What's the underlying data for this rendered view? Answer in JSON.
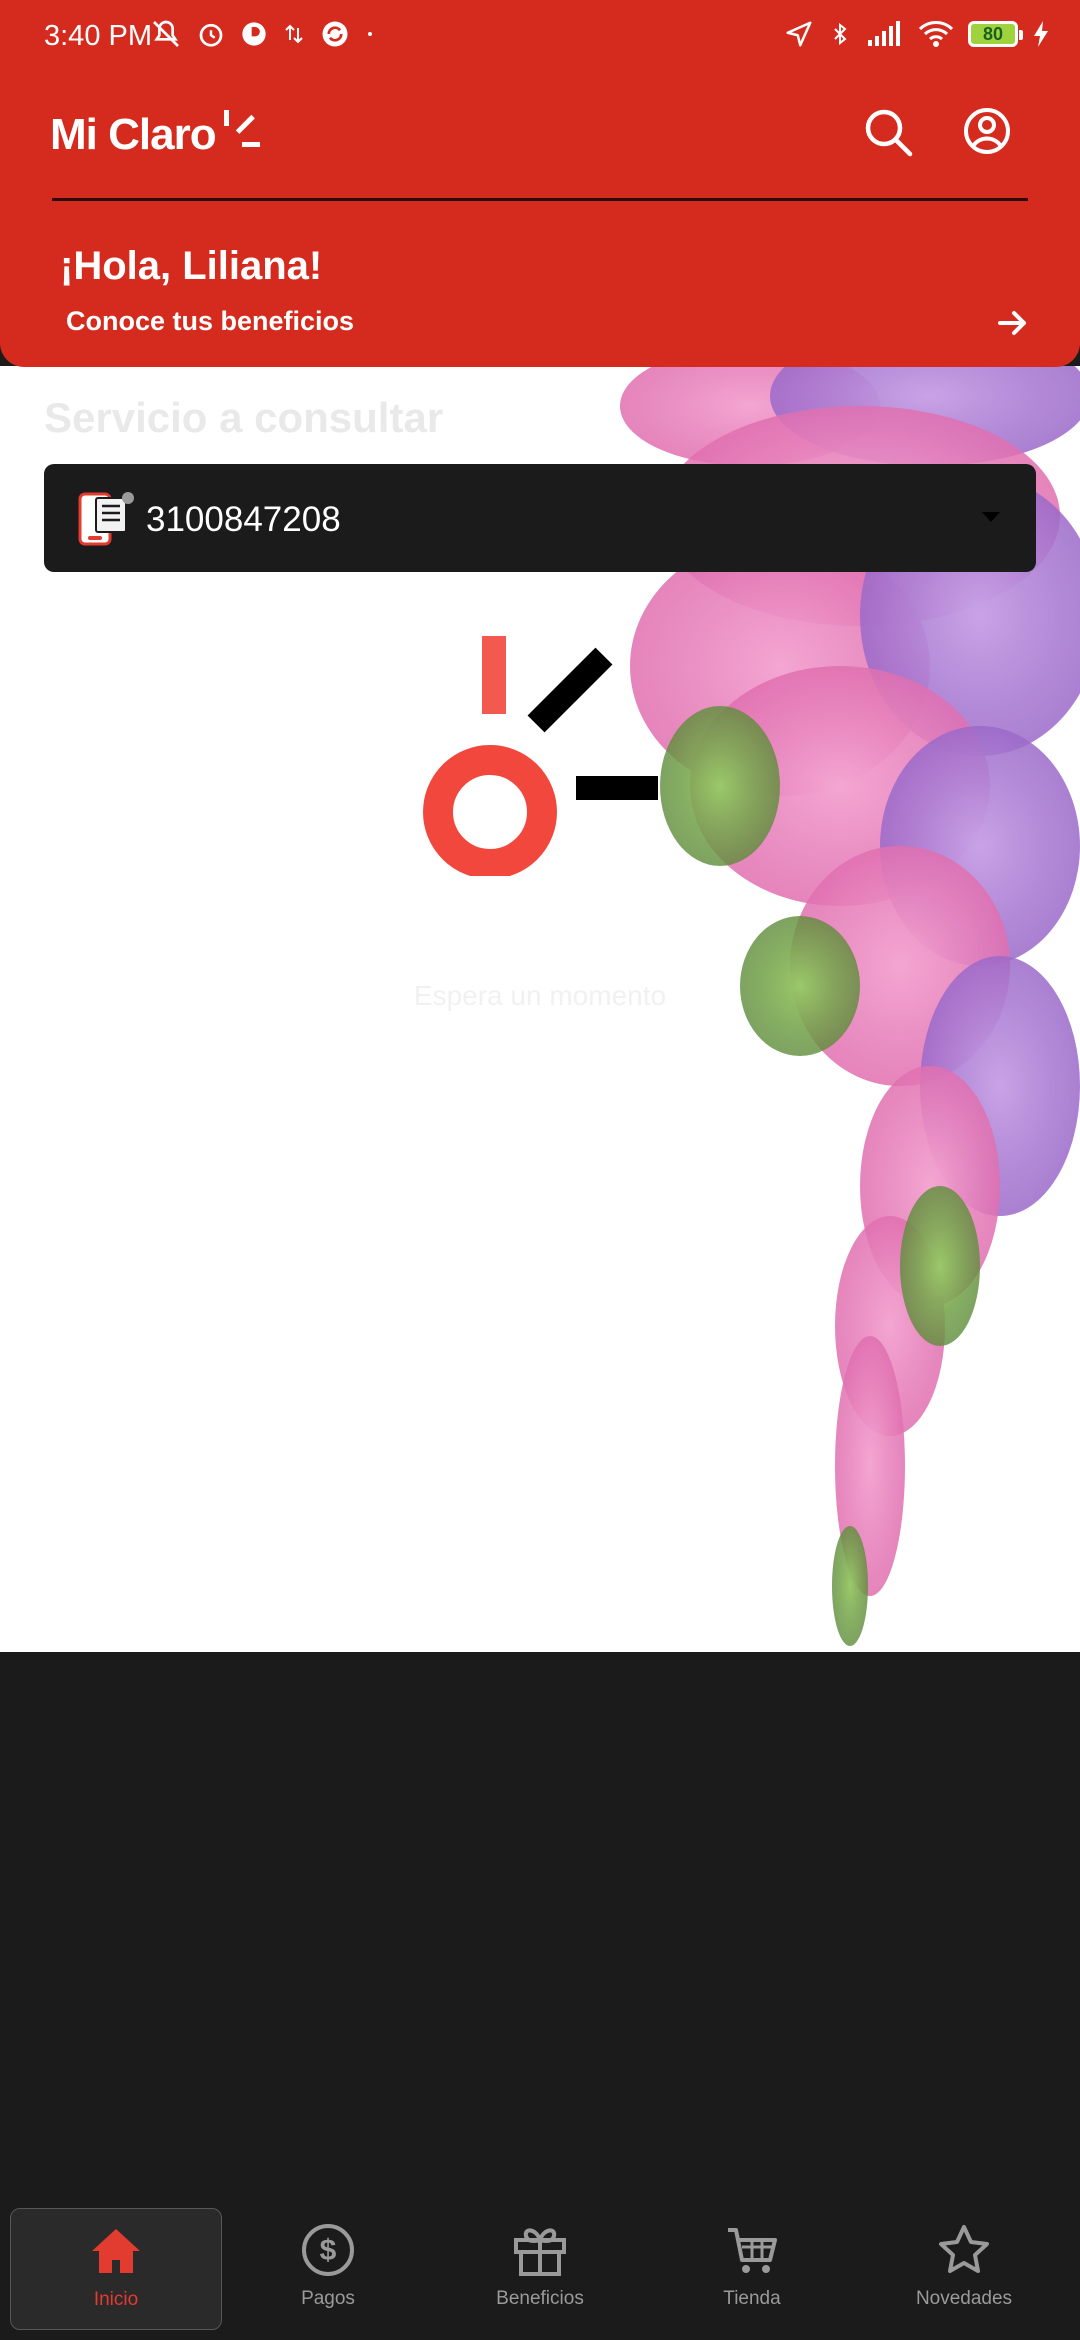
{
  "status_bar": {
    "time": "3:40 PM",
    "battery": "80"
  },
  "header": {
    "logo_text": "Mi Claro",
    "greeting": "¡Hola, Liliana!",
    "benefits_link": "Conoce tus beneficios"
  },
  "content": {
    "section_title": "Servicio a consultar",
    "selected_service": "3100847208",
    "loading_text": "Espera un momento"
  },
  "bottom_nav": {
    "items": [
      {
        "label": "Inicio",
        "icon": "home-icon",
        "active": true
      },
      {
        "label": "Pagos",
        "icon": "dollar-icon",
        "active": false
      },
      {
        "label": "Beneficios",
        "icon": "gift-icon",
        "active": false
      },
      {
        "label": "Tienda",
        "icon": "cart-icon",
        "active": false
      },
      {
        "label": "Novedades",
        "icon": "star-icon",
        "active": false
      }
    ]
  },
  "colors": {
    "brand_red": "#d52b1e",
    "dark_bg": "#1b1b1c",
    "active_nav": "#e23b2f"
  }
}
